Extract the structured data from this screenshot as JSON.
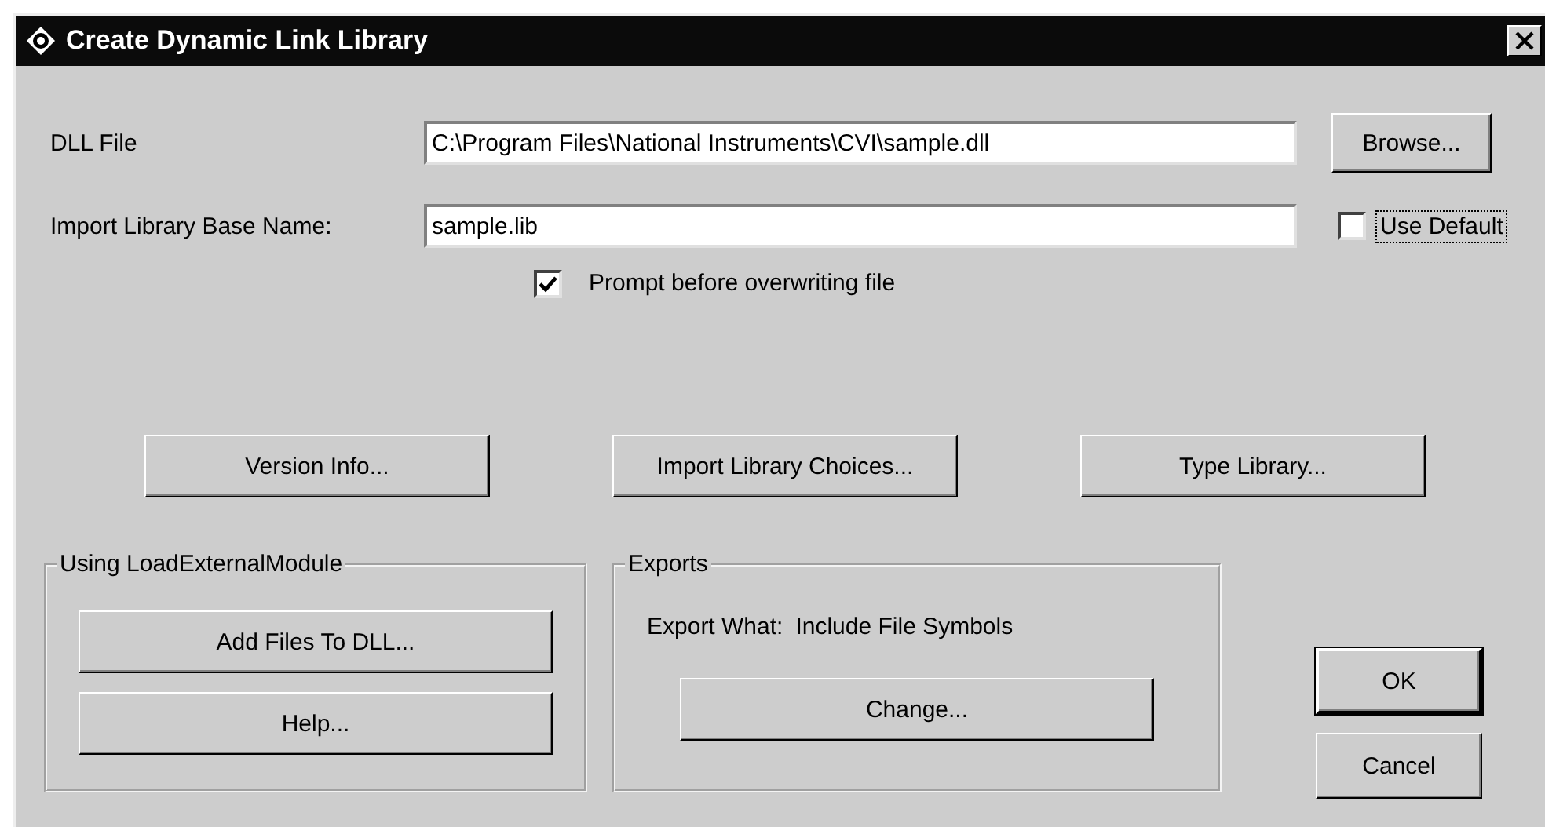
{
  "window": {
    "title": "Create Dynamic Link Library"
  },
  "dll_file": {
    "label": "DLL File",
    "value": "C:\\Program Files\\National Instruments\\CVI\\sample.dll",
    "button": "Browse..."
  },
  "import_library": {
    "label": "Import Library Base Name:",
    "value": "sample.lib"
  },
  "use_default": {
    "label": "Use Default",
    "checked": false,
    "focused": true
  },
  "prompt_overwrite": {
    "label": "Prompt before overwriting file",
    "checked": true
  },
  "buttons": [
    "Version Info...",
    "Import Library Choices...",
    "Type Library..."
  ],
  "load_external_module": {
    "title": "Using LoadExternalModule",
    "buttons": [
      "Add Files To DLL...",
      "Help..."
    ]
  },
  "exports": {
    "title": "Exports",
    "export_what_label": "Export What:",
    "export_what_value": "Include File Symbols",
    "buttons": [
      "Change..."
    ]
  },
  "dialog_buttons": [
    {
      "label": "OK",
      "default": true
    },
    {
      "label": "Cancel",
      "default": false
    }
  ]
}
